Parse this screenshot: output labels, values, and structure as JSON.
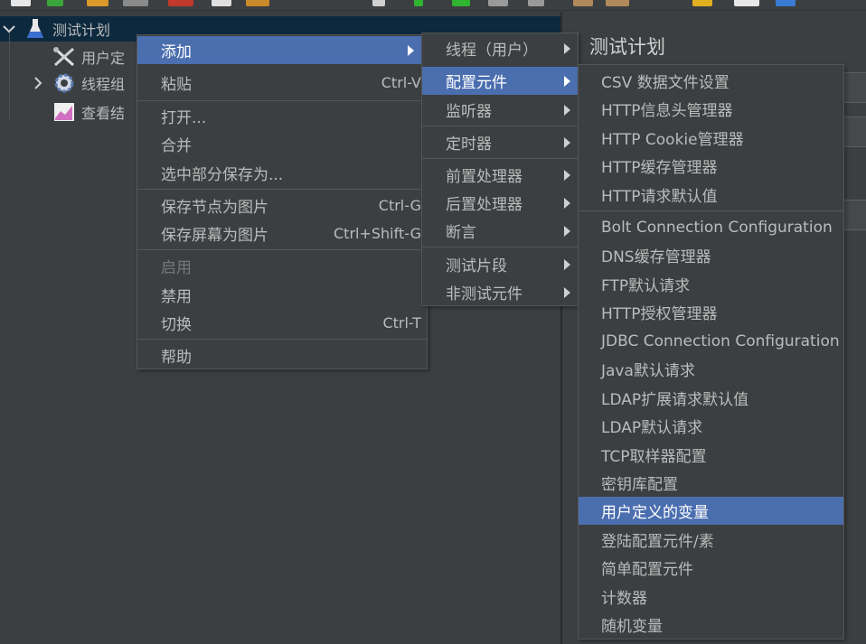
{
  "toolbar": {
    "icons": [
      "new-icon",
      "templates-icon",
      "open-icon",
      "save-icon",
      "cut-icon",
      "copy-icon",
      "paste-icon",
      "expand-icon",
      "start-icon",
      "start-no-pause-icon",
      "stop-icon",
      "shutdown-icon",
      "clear-icon",
      "clear-all-icon",
      "search-icon",
      "reset-search-icon",
      "function-helper-icon",
      "help-icon"
    ]
  },
  "tree": {
    "root": "测试计划",
    "items": [
      "用户定",
      "线程组",
      "查看结"
    ]
  },
  "right_panel": {
    "title": "测试计划"
  },
  "menu_main": {
    "items": [
      {
        "label": "添加",
        "submenu": true
      },
      {
        "label": "粘贴",
        "accel": "Ctrl-V"
      },
      {
        "label": "打开..."
      },
      {
        "label": "合并"
      },
      {
        "label": "选中部分保存为..."
      },
      {
        "label": "保存节点为图片",
        "accel": "Ctrl-G"
      },
      {
        "label": "保存屏幕为图片",
        "accel": "Ctrl+Shift-G"
      },
      {
        "label": "启用",
        "disabled": true
      },
      {
        "label": "禁用"
      },
      {
        "label": "切换",
        "accel": "Ctrl-T"
      },
      {
        "label": "帮助"
      }
    ]
  },
  "menu_add": {
    "items": [
      {
        "label": "线程（用户）"
      },
      {
        "label": "配置元件"
      },
      {
        "label": "监听器"
      },
      {
        "label": "定时器"
      },
      {
        "label": "前置处理器"
      },
      {
        "label": "后置处理器"
      },
      {
        "label": "断言"
      },
      {
        "label": "测试片段"
      },
      {
        "label": "非测试元件"
      }
    ]
  },
  "menu_config": {
    "items": [
      "CSV 数据文件设置",
      "HTTP信息头管理器",
      "HTTP Cookie管理器",
      "HTTP缓存管理器",
      "HTTP请求默认值",
      "Bolt Connection Configuration",
      "DNS缓存管理器",
      "FTP默认请求",
      "HTTP授权管理器",
      "JDBC Connection Configuration",
      "Java默认请求",
      "LDAP扩展请求默认值",
      "LDAP默认请求",
      "TCP取样器配置",
      "密钥库配置",
      "用户定义的变量",
      "登陆配置元件/素",
      "简单配置元件",
      "计数器",
      "随机变量"
    ]
  },
  "colors": {
    "background": "#3c3f41",
    "highlight": "#4b6eaf",
    "tree_selection": "#0d293e",
    "text": "#bbbbbb"
  }
}
